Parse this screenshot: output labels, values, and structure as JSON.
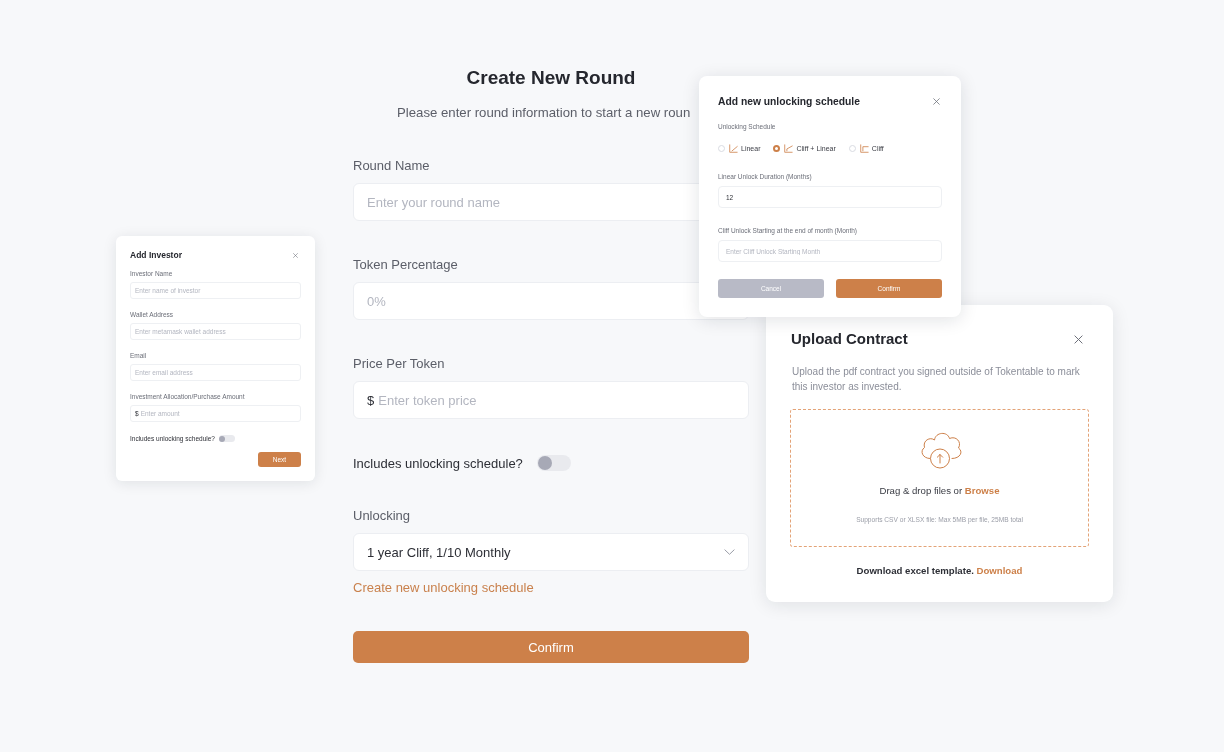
{
  "add_investor_dialog": {
    "title": "Add Investor",
    "fields": [
      {
        "kind": "text",
        "label": "Investor Name",
        "placeholder": "Enter name of investor"
      },
      {
        "kind": "text",
        "label": "Wallet Address",
        "placeholder": "Enter metamask wallet address"
      },
      {
        "kind": "text",
        "label": "Email",
        "placeholder": "Enter email address"
      },
      {
        "kind": "currency",
        "label": "Investment Allocation/Purchase Amount",
        "prefix": "$",
        "placeholder": "Enter amount"
      }
    ],
    "toggle": {
      "label": "Includes unlocking schedule?",
      "on": false
    },
    "next_button": "Next"
  },
  "main_form": {
    "title": "Create New Round",
    "subtitle": "Please enter round information to start a new roun",
    "fields": [
      {
        "kind": "text",
        "label": "Round Name",
        "placeholder": "Enter your round name"
      },
      {
        "kind": "text",
        "label": "Token Percentage",
        "placeholder": "0%"
      },
      {
        "kind": "currency",
        "label": "Price Per Token",
        "prefix": "$",
        "placeholder": "Enter token price"
      },
      {
        "kind": "toggle",
        "label": "Includes unlocking schedule?",
        "on": false
      },
      {
        "kind": "select",
        "label": "Unlocking",
        "value": "1 year Cliff, 1/10 Monthly"
      }
    ],
    "create_link": "Create new unlocking schedule",
    "confirm_button": "Confirm"
  },
  "unlocking_schedule_dialog": {
    "title": "Add new unlocking schedule",
    "schedule_label": "Unlocking Schedule",
    "options": [
      {
        "kind": "linear",
        "label": "Linear",
        "selected": false
      },
      {
        "kind": "cliff_linear",
        "label": "Cliff + Linear",
        "selected": true
      },
      {
        "kind": "cliff",
        "label": "Cliff",
        "selected": false
      }
    ],
    "fields": [
      {
        "label": "Linear Unlock Duration (Months)",
        "value": "12"
      },
      {
        "label": "Cliff Unlock Starting at the end of month (Month)",
        "placeholder": "Enter Cliff Unlock Starting Month"
      }
    ],
    "cancel_button": "Cancel",
    "confirm_button": "Confirm"
  },
  "upload_contract_dialog": {
    "title": "Upload Contract",
    "description": "Upload the pdf contract you signed outside of Tokentable to mark this investor as invested.",
    "drop_text": "Drag & drop files or",
    "browse_link": "Browse",
    "supports_text": "Supports CSV or XLSX file: Max 5MB per file, 25MB total",
    "template_text": "Download excel template.",
    "download_link": "Download"
  }
}
